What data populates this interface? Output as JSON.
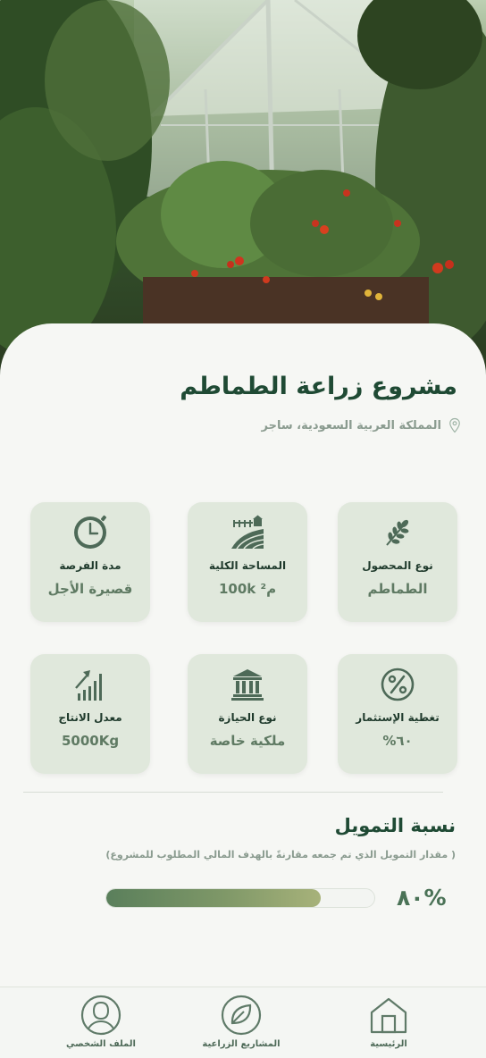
{
  "project": {
    "title": "مشروع زراعة الطماطم",
    "location": "المملكة العربية السعودية، ساجر"
  },
  "stats": [
    {
      "icon": "wheat-icon",
      "label": "نوع المحصول",
      "value": "الطماطم"
    },
    {
      "icon": "farmland-icon",
      "label": "المساحة الكلية",
      "value": "م² 100k"
    },
    {
      "icon": "clock-icon",
      "label": "مدة الفرصة",
      "value": "قصيرة الأجل"
    },
    {
      "icon": "percent-icon",
      "label": "تغطية الإستثمار",
      "value": "٦٠%"
    },
    {
      "icon": "bank-icon",
      "label": "نوع الحيازة",
      "value": "ملكية خاصة"
    },
    {
      "icon": "growth-chart-icon",
      "label": "معدل الانتاج",
      "value": "5000Kg"
    }
  ],
  "funding": {
    "title": "نسبة التمويل",
    "subtitle": "( مقدار التمويل الذي تم جمعه مقارنةً بالهدف المالي المطلوب للمشروع)",
    "percent_label": "٨٠%",
    "progress": 0.8
  },
  "nav": {
    "items": [
      {
        "icon": "home-icon",
        "label": "الرئيسية"
      },
      {
        "icon": "leaf-icon",
        "label": "المشاريع الزراعية"
      },
      {
        "icon": "user-icon",
        "label": "الملف الشخصي"
      }
    ]
  },
  "colors": {
    "accent": "#1f4a34",
    "card_bg": "#e0e8dc",
    "progress_start": "#5a7f5b",
    "progress_end": "#a7b27a"
  }
}
